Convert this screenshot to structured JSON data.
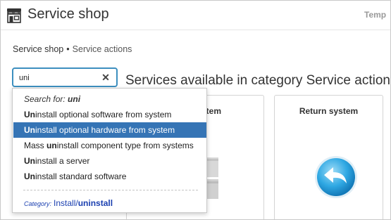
{
  "header": {
    "title": "Service shop",
    "right_text": "Temp"
  },
  "breadcrumb": {
    "items": [
      "Service shop",
      "Service actions"
    ],
    "separator": "•"
  },
  "search": {
    "value": "uni",
    "clear_icon": "close-icon"
  },
  "section_heading": "Services available in category Service actions",
  "cards": [
    {
      "title": "stem"
    },
    {
      "title": "Return system",
      "icon": "return-arrow-icon"
    }
  ],
  "dropdown": {
    "search_for_label": "Search for:",
    "search_for_term": "uni",
    "items": [
      {
        "pre": "",
        "match": "Un",
        "post": "install optional software from system",
        "selected": false
      },
      {
        "pre": "",
        "match": "Un",
        "post": "install optional hardware from system",
        "selected": true
      },
      {
        "pre": "Mass ",
        "match": "un",
        "post": "install component type from systems",
        "selected": false
      },
      {
        "pre": "",
        "match": "Un",
        "post": "install a server",
        "selected": false
      },
      {
        "pre": "",
        "match": "Un",
        "post": "install standard software",
        "selected": false
      }
    ],
    "category_label": "Category:",
    "category_pre": "Install/",
    "category_match": "uninstall"
  },
  "colors": {
    "accent": "#3d8fbf",
    "selected": "#3574b5",
    "link": "#1a3fb0"
  }
}
